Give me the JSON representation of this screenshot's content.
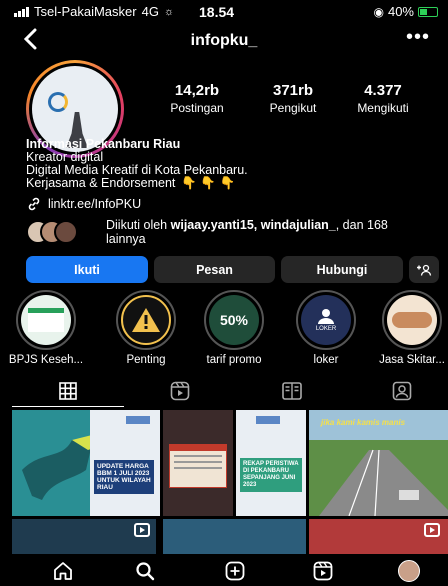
{
  "status_bar": {
    "carrier": "Tsel-PakaiMasker",
    "network": "4G",
    "time": "18.54",
    "battery": "40%"
  },
  "header": {
    "handle": "infopku_",
    "back_icon": "chevron-left-icon",
    "more_icon": "ellipsis-icon"
  },
  "stats": [
    {
      "value": "14,2rb",
      "label": "Postingan"
    },
    {
      "value": "371rb",
      "label": "Pengikut"
    },
    {
      "value": "4.377",
      "label": "Mengikuti"
    }
  ],
  "bio": {
    "name": "Informasi Pekanbaru Riau",
    "category": "Kreator digital",
    "line1": "Digital Media Kreatif di Kota Pekanbaru.",
    "line2": "Kerjasama & Endorsement",
    "emojis": "👇 👇 👇",
    "link": "linktr.ee/InfoPKU"
  },
  "followed_by": {
    "prefix": "Diikuti oleh ",
    "names": "wijaay.yanti15, windajulian_",
    "suffix": ", dan 168 lainnya"
  },
  "actions": {
    "follow": "Ikuti",
    "message": "Pesan",
    "contact": "Hubungi",
    "add_user": "+⚇"
  },
  "highlights": [
    {
      "label": "BPJS Keseh..."
    },
    {
      "label": "Penting"
    },
    {
      "label": "tarif promo",
      "badge": "50%"
    },
    {
      "label": "loker",
      "badge": "LOKER"
    },
    {
      "label": "Jasa Skitar..."
    }
  ],
  "tabs": [
    "grid-icon",
    "reels-icon",
    "guides-icon",
    "tagged-icon"
  ],
  "posts": [
    {
      "text": ""
    },
    {
      "text": "UPDATE HARGA BBM 1 JULI 2023 UNTUK WILAYAH RIAU"
    },
    {
      "text": ""
    },
    {
      "text": "REKAP PERISTIWA DI PEKANBARU SEPANJANG JUNI 2023"
    },
    {
      "text": "jika kami kamis manis"
    }
  ],
  "bottom_nav": [
    "home-icon",
    "search-icon",
    "new-post-icon",
    "reels-icon",
    "profile-avatar"
  ],
  "colors": {
    "accent": "#1877f2",
    "button": "#262626",
    "background": "#000000"
  }
}
